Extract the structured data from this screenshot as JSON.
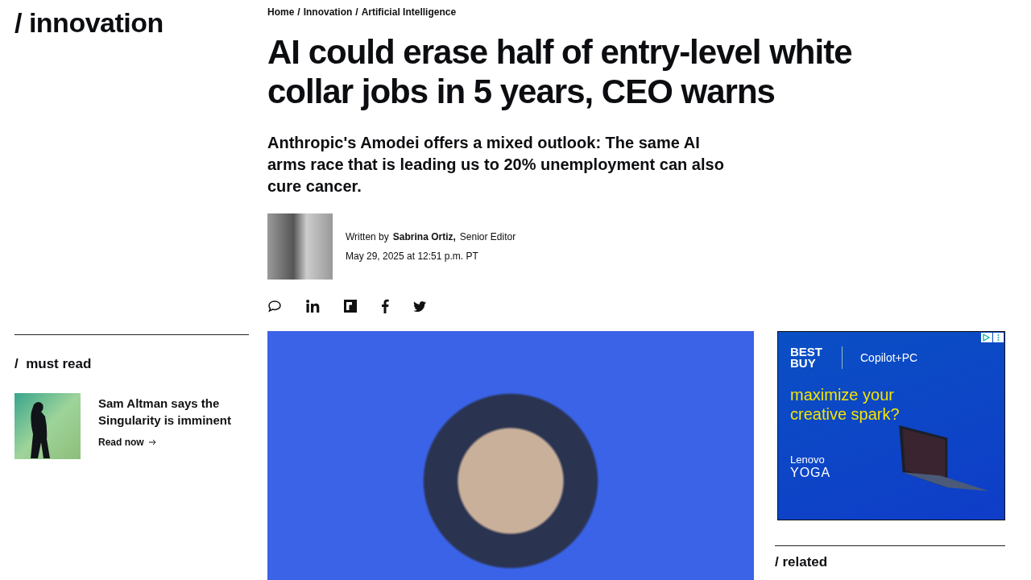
{
  "section": {
    "slash": "/",
    "label": "innovation"
  },
  "breadcrumbs": [
    "Home",
    "Innovation",
    "Artificial Intelligence"
  ],
  "breadcrumb_separator": "/",
  "headline": "AI could erase half of entry-level white collar jobs in 5 years, CEO warns",
  "dek": "Anthropic's Amodei offers a mixed outlook: The same AI arms race that is leading us to 20% unemployment can also cure cancer.",
  "byline": {
    "prefix": "Written by",
    "author": "Sabrina Ortiz,",
    "role": "Senior Editor",
    "date": "May 29, 2025 at 12:51 p.m. PT"
  },
  "share_buttons": [
    {
      "kind": "comment"
    },
    {
      "kind": "linkedin"
    },
    {
      "kind": "flipboard"
    },
    {
      "kind": "facebook"
    },
    {
      "kind": "twitter"
    }
  ],
  "must_read": {
    "slash": "/",
    "title": "must read",
    "items": [
      {
        "title": "Sam Altman says the Singularity is imminent",
        "link": "Read now"
      }
    ]
  },
  "ad": {
    "brand": "BEST BUY",
    "partner": "Copilot+PC",
    "headline": "maximize your creative spark?",
    "maker": "Lenovo",
    "product": "YOGA"
  },
  "related": {
    "slash": "/",
    "title": "related"
  }
}
